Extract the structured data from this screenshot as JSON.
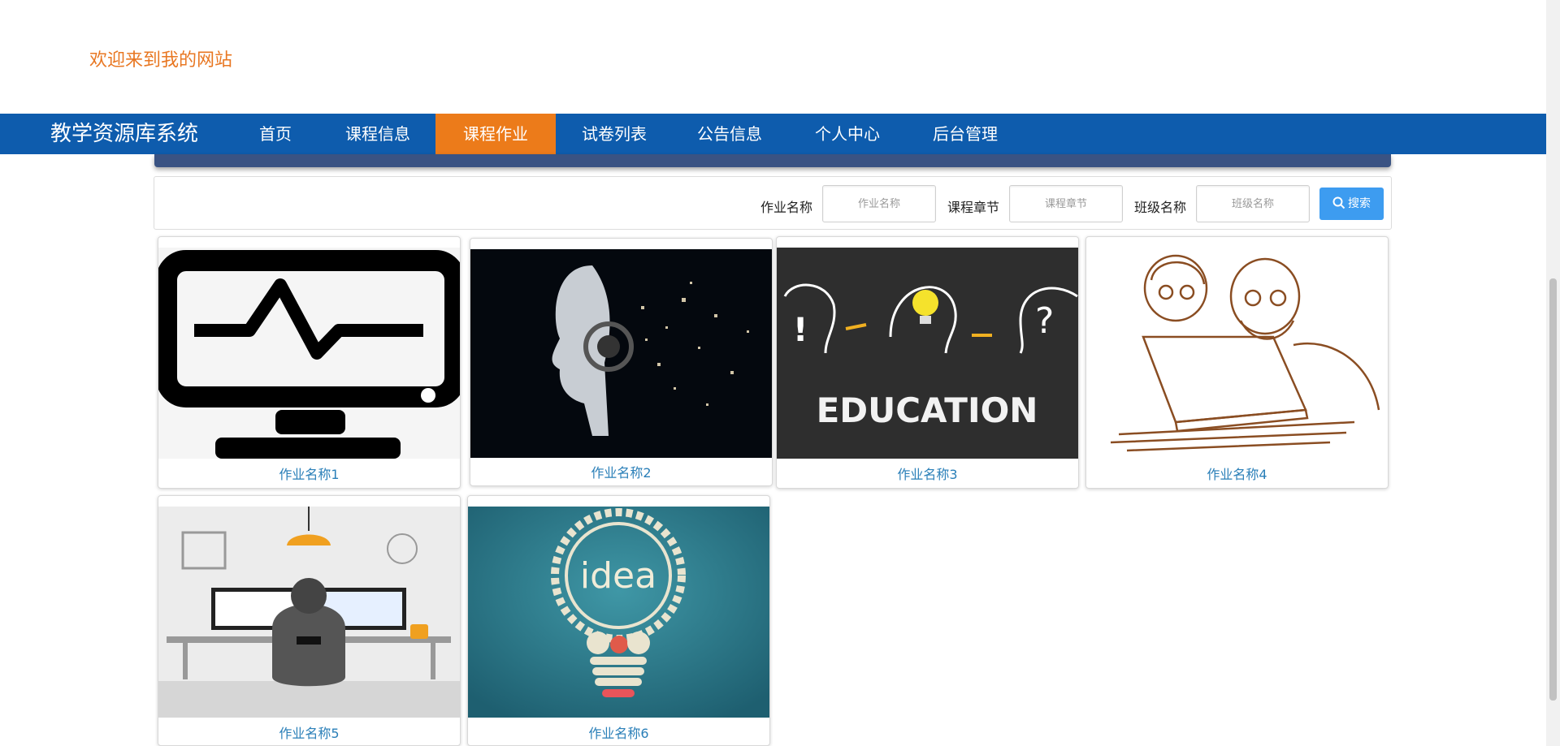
{
  "header": {
    "welcome": "欢迎来到我的网站"
  },
  "nav": {
    "brand": "教学资源库系统",
    "items": [
      {
        "label": "首页"
      },
      {
        "label": "课程信息"
      },
      {
        "label": "课程作业",
        "active": true
      },
      {
        "label": "试卷列表"
      },
      {
        "label": "公告信息"
      },
      {
        "label": "个人中心"
      },
      {
        "label": "后台管理"
      }
    ]
  },
  "search": {
    "fields": [
      {
        "label": "作业名称",
        "placeholder": "作业名称"
      },
      {
        "label": "课程章节",
        "placeholder": "课程章节"
      },
      {
        "label": "班级名称",
        "placeholder": "班级名称"
      }
    ],
    "button": "搜索"
  },
  "cards": [
    {
      "title": "作业名称1",
      "image": "monitor-pulse-icon"
    },
    {
      "title": "作业名称2",
      "image": "ai-robot-head"
    },
    {
      "title": "作业名称3",
      "image": "education-chalkboard",
      "image_text": "EDUCATION"
    },
    {
      "title": "作业名称4",
      "image": "people-laptop-sketch"
    },
    {
      "title": "作业名称5",
      "image": "person-at-computer-desk"
    },
    {
      "title": "作业名称6",
      "image": "idea-gear-bulb",
      "image_text": "idea"
    }
  ],
  "colors": {
    "nav_bg": "#0e5cad",
    "nav_active": "#ec7b1a",
    "welcome": "#e87722",
    "caption": "#2a7fb8",
    "search_btn": "#3d9cf0"
  }
}
